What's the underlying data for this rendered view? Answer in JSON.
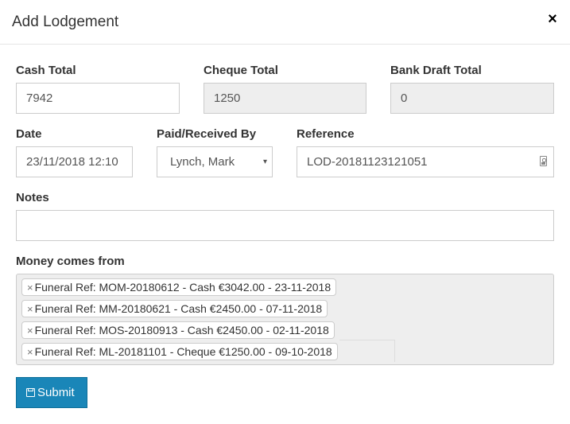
{
  "modal": {
    "title": "Add Lodgement",
    "close_glyph": "×"
  },
  "fields": {
    "cash_total": {
      "label": "Cash Total",
      "value": "7942"
    },
    "cheque_total": {
      "label": "Cheque Total",
      "value": "1250"
    },
    "bank_draft_total": {
      "label": "Bank Draft Total",
      "value": "0"
    },
    "date": {
      "label": "Date",
      "value": "23/11/2018 12:10"
    },
    "paid_by": {
      "label": "Paid/Received By",
      "value": "Lynch, Mark",
      "caret": "▾"
    },
    "reference": {
      "label": "Reference",
      "value": "LOD-20181123121051",
      "icon": "contact-card-icon"
    },
    "notes": {
      "label": "Notes",
      "value": ""
    },
    "money_from": {
      "label": "Money comes from",
      "remove_glyph": "×",
      "tags": [
        "Funeral Ref: MOM-20180612 - Cash €3042.00 - 23-11-2018",
        "Funeral Ref: MM-20180621 - Cash €2450.00 - 07-11-2018",
        "Funeral Ref: MOS-20180913 - Cash €2450.00 - 02-11-2018",
        "Funeral Ref: ML-20181101 - Cheque €1250.00 - 09-10-2018"
      ]
    }
  },
  "submit": {
    "label": "Submit",
    "icon": "save-icon"
  },
  "colors": {
    "primary": "#1a86b8",
    "disabled_bg": "#eeeeee",
    "border": "#cccccc"
  }
}
